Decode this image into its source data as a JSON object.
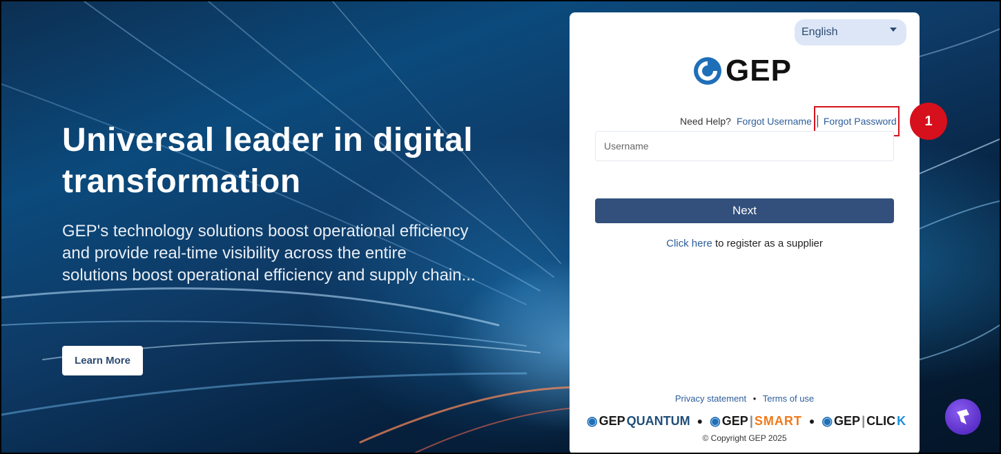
{
  "hero": {
    "title": "Universal leader in digital transformation",
    "description": "GEP's technology solutions boost operational efficiency and provide real-time visibility across the entire solutions boost operational efficiency and supply chain...",
    "learn_more_label": "Learn More"
  },
  "login": {
    "language_selected": "English",
    "logo_text": "GEP",
    "need_help_label": "Need Help?",
    "forgot_username_label": "Forgot Username",
    "forgot_password_label": "Forgot Password",
    "username_placeholder": "Username",
    "next_label": "Next",
    "register_link_label": "Click here",
    "register_text": "to register as a supplier",
    "privacy_label": "Privacy statement",
    "terms_label": "Terms of use",
    "brands": [
      {
        "prefix": "GEP",
        "product": "QUANTUM"
      },
      {
        "prefix": "GEP",
        "product": "SMART"
      },
      {
        "prefix": "GEP",
        "product": "CLIC",
        "suffix": "K"
      }
    ],
    "copyright": "© Copyright GEP 2025"
  },
  "annotation": {
    "step_number": "1",
    "color": "#d6101c"
  },
  "colors": {
    "primary_button": "#33507c",
    "link": "#2c5d99",
    "language_bg": "#dde6f7"
  }
}
